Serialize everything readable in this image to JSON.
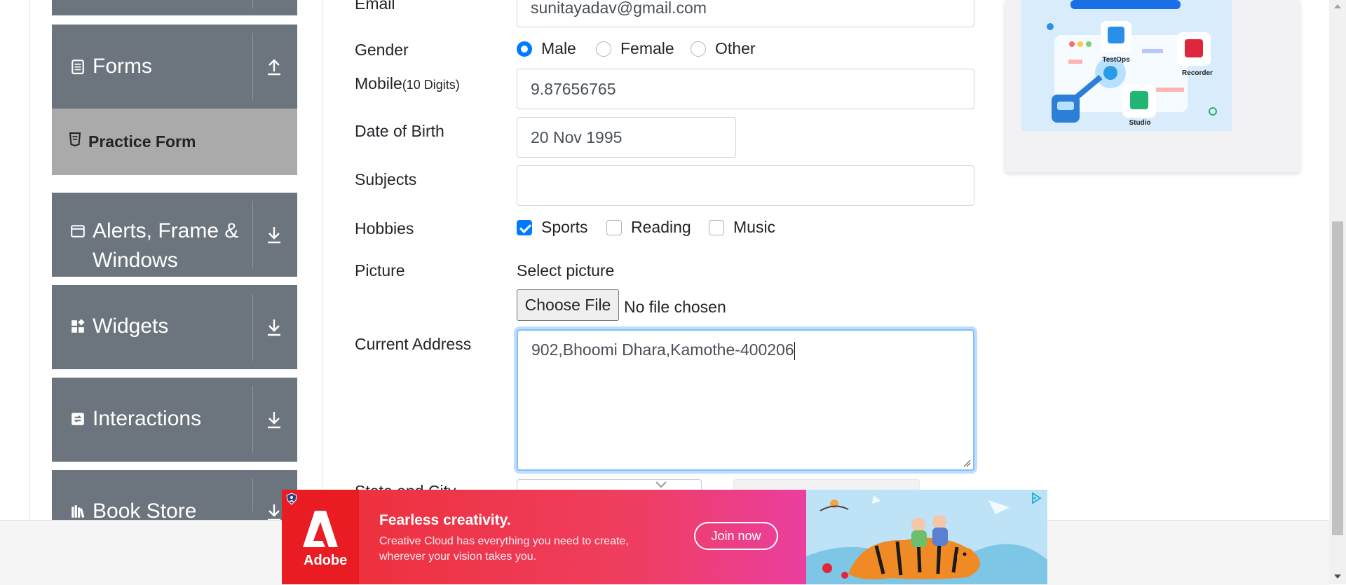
{
  "sidebar": {
    "groups": [
      {
        "label": "Forms",
        "arrow": "up"
      },
      {
        "label": "Alerts, Frame &",
        "label2": "Windows",
        "arrow": "down"
      },
      {
        "label": "Widgets",
        "arrow": "down"
      },
      {
        "label": "Interactions",
        "arrow": "down"
      },
      {
        "label": "Book Store",
        "arrow": "down"
      }
    ],
    "active_item": "Practice Form"
  },
  "form": {
    "email": {
      "label": "Email",
      "value": "sunitayadav@gmail.com"
    },
    "gender": {
      "label": "Gender",
      "options": [
        "Male",
        "Female",
        "Other"
      ],
      "selected": "Male"
    },
    "mobile": {
      "label": "Mobile",
      "label_hint": "(10 Digits)",
      "value": "9.87656765"
    },
    "dob": {
      "label": "Date of Birth",
      "value": "20 Nov 1995"
    },
    "subjects": {
      "label": "Subjects",
      "value": ""
    },
    "hobbies": {
      "label": "Hobbies",
      "options": [
        "Sports",
        "Reading",
        "Music"
      ],
      "checked": [
        "Sports"
      ]
    },
    "picture": {
      "label": "Picture",
      "select_label": "Select picture",
      "button": "Choose File",
      "status": "No file chosen"
    },
    "address": {
      "label": "Current Address",
      "value": "902,Bhoomi Dhara,Kamothe-400206"
    },
    "state_city_label": "State and City"
  },
  "promo": {
    "labels": [
      "TestOps",
      "Recorder",
      "Studio"
    ]
  },
  "ad": {
    "brand": "Adobe",
    "headline": "Fearless creativity.",
    "body": "Creative Cloud has everything you need to create, wherever your vision takes you.",
    "cta": "Join now"
  }
}
